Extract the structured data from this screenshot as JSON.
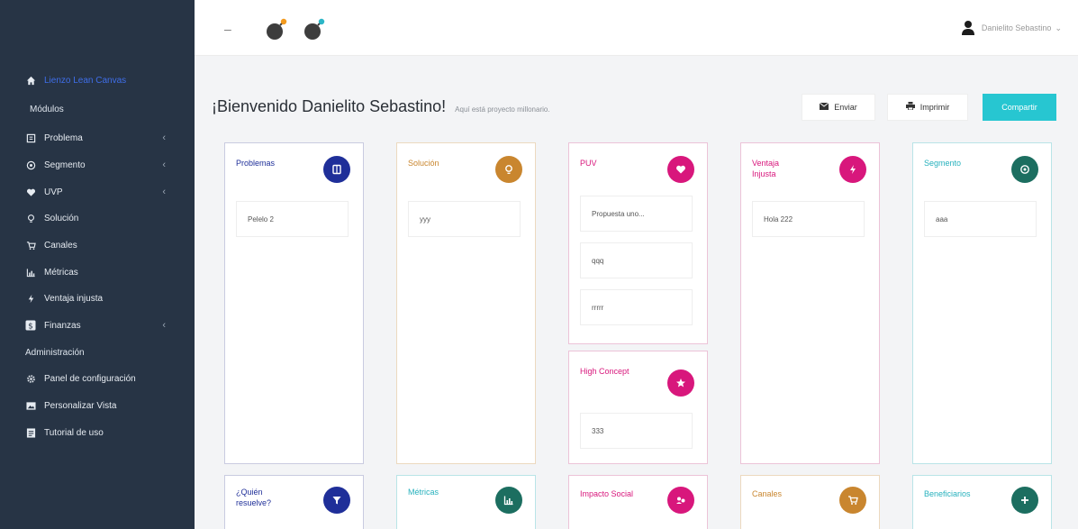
{
  "sidebar": {
    "brand_label": "Lienzo Lean Canvas",
    "section_modules": "Módulos",
    "section_admin": "Administración",
    "items": [
      {
        "label": "Problema",
        "icon": "book-icon",
        "chevron": "‹"
      },
      {
        "label": "Segmento",
        "icon": "target-icon",
        "chevron": "‹"
      },
      {
        "label": "UVP",
        "icon": "heart-icon",
        "chevron": "‹"
      },
      {
        "label": "Solución",
        "icon": "lightbulb-icon",
        "chevron": ""
      },
      {
        "label": "Canales",
        "icon": "cart-icon",
        "chevron": ""
      },
      {
        "label": "Métricas",
        "icon": "chart-icon",
        "chevron": ""
      },
      {
        "label": "Ventaja injusta",
        "icon": "bolt-icon",
        "chevron": ""
      },
      {
        "label": "Finanzas",
        "icon": "dollar-icon",
        "chevron": "‹"
      }
    ],
    "admin_items": [
      {
        "label": "Panel de configuración",
        "icon": "gear-icon"
      },
      {
        "label": "Personalizar Vista",
        "icon": "image-icon"
      },
      {
        "label": "Tutorial de uso",
        "icon": "document-icon"
      }
    ]
  },
  "topbar": {
    "collapse_symbol": "–",
    "user_name": "Danielito Sebastino",
    "user_caret": "⌄"
  },
  "welcome": {
    "title": "¡Bienvenido Danielito Sebastino!",
    "subtitle": "Aquí está proyecto millonario."
  },
  "actions": {
    "send_label": "Enviar",
    "print_label": "Imprimir",
    "share_label": "Compartir"
  },
  "colors": {
    "problem": "#1f2f99",
    "solution": "#c9862f",
    "uvp": "#d8177c",
    "segment": "#1c6e60",
    "share": "#27c6d1"
  },
  "cards": {
    "problemas": {
      "title": "Problemas",
      "notes": [
        "Pelelo 2"
      ]
    },
    "solucion": {
      "title": "Solución",
      "notes": [
        "yyy"
      ]
    },
    "pvu": {
      "title": "PUV",
      "notes": [
        "Propuesta uno...",
        "qqq",
        "rrrrr"
      ]
    },
    "ventaja": {
      "title": "Ventaja\nInjusta",
      "notes": [
        "Hola 222"
      ]
    },
    "segmento": {
      "title": "Segmento",
      "notes": [
        "aaa"
      ]
    },
    "high_concept": {
      "title": "High Concept",
      "notes": [
        "333"
      ]
    },
    "quien": {
      "title": "¿Quién\nresuelve?"
    },
    "metricas": {
      "title": "Métricas"
    },
    "impacto": {
      "title": "Impacto Social"
    },
    "canales": {
      "title": "Canales"
    },
    "beneficiarios": {
      "title": "Beneficiarios"
    }
  }
}
